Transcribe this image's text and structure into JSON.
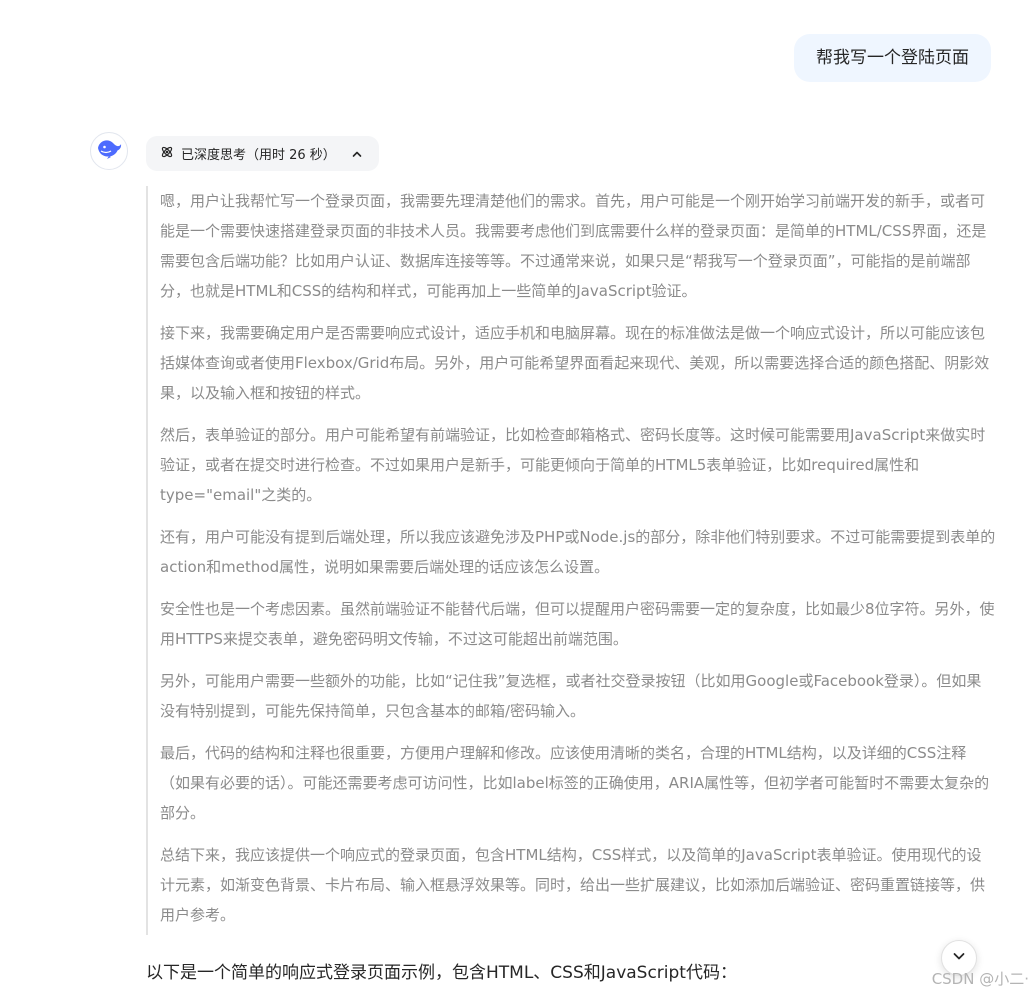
{
  "user_message": "帮我写一个登陆页面",
  "thinking": {
    "label": "已深度思考（用时 26 秒）",
    "paragraphs": [
      "嗯，用户让我帮忙写一个登录页面，我需要先理清楚他们的需求。首先，用户可能是一个刚开始学习前端开发的新手，或者可能是一个需要快速搭建登录页面的非技术人员。我需要考虑他们到底需要什么样的登录页面：是简单的HTML/CSS界面，还是需要包含后端功能？比如用户认证、数据库连接等等。不过通常来说，如果只是“帮我写一个登录页面”，可能指的是前端部分，也就是HTML和CSS的结构和样式，可能再加上一些简单的JavaScript验证。",
      "接下来，我需要确定用户是否需要响应式设计，适应手机和电脑屏幕。现在的标准做法是做一个响应式设计，所以可能应该包括媒体查询或者使用Flexbox/Grid布局。另外，用户可能希望界面看起来现代、美观，所以需要选择合适的颜色搭配、阴影效果，以及输入框和按钮的样式。",
      "然后，表单验证的部分。用户可能希望有前端验证，比如检查邮箱格式、密码长度等。这时候可能需要用JavaScript来做实时验证，或者在提交时进行检查。不过如果用户是新手，可能更倾向于简单的HTML5表单验证，比如required属性和type=\"email\"之类的。",
      "还有，用户可能没有提到后端处理，所以我应该避免涉及PHP或Node.js的部分，除非他们特别要求。不过可能需要提到表单的action和method属性，说明如果需要后端处理的话应该怎么设置。",
      "安全性也是一个考虑因素。虽然前端验证不能替代后端，但可以提醒用户密码需要一定的复杂度，比如最少8位字符。另外，使用HTTPS来提交表单，避免密码明文传输，不过这可能超出前端范围。",
      "另外，可能用户需要一些额外的功能，比如“记住我”复选框，或者社交登录按钮（比如用Google或Facebook登录）。但如果没有特别提到，可能先保持简单，只包含基本的邮箱/密码输入。",
      "最后，代码的结构和注释也很重要，方便用户理解和修改。应该使用清晰的类名，合理的HTML结构，以及详细的CSS注释（如果有必要的话）。可能还需要考虑可访问性，比如label标签的正确使用，ARIA属性等，但初学者可能暂时不需要太复杂的部分。",
      "总结下来，我应该提供一个响应式的登录页面，包含HTML结构，CSS样式，以及简单的JavaScript表单验证。使用现代的设计元素，如渐变色背景、卡片布局、输入框悬浮效果等。同时，给出一些扩展建议，比如添加后端验证、密码重置链接等，供用户参考。"
    ]
  },
  "answer_intro": "以下是一个简单的响应式登录页面示例，包含HTML、CSS和JavaScript代码：",
  "watermark": "CSDN @小二·",
  "icons": {
    "avatar": "deepseek-whale-icon",
    "thinking": "deep-think-atom-icon",
    "collapse": "chevron-up-icon",
    "scroll_down": "chevron-down-icon"
  },
  "colors": {
    "user_bubble_bg": "#eff6ff",
    "brand_blue": "#4d6bfe",
    "thought_text": "#8b8b8b",
    "body_text": "#262626"
  }
}
